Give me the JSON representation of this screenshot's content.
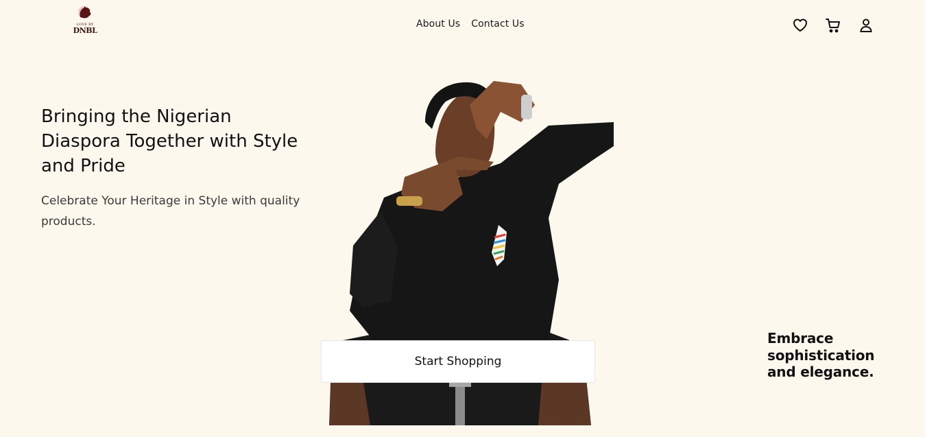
{
  "brand": {
    "logo_small_text": "LOVE BY",
    "logo_text": "DNBL"
  },
  "nav": {
    "items": [
      {
        "label": "About Us"
      },
      {
        "label": "Contact Us"
      }
    ]
  },
  "header_icons": [
    "heart-icon",
    "cart-icon",
    "user-icon"
  ],
  "hero": {
    "title": "Bringing the Nigerian Diaspora Together with Style and Pride",
    "subtitle": "Celebrate Your Heritage in Style with quality products.",
    "cta_label": "Start Shopping",
    "tagline": "Embrace sophistication and elegance."
  },
  "colors": {
    "background": "#fdf8ee",
    "text": "#111111",
    "brand": "#3b1010",
    "cta_background": "#ffffff"
  }
}
